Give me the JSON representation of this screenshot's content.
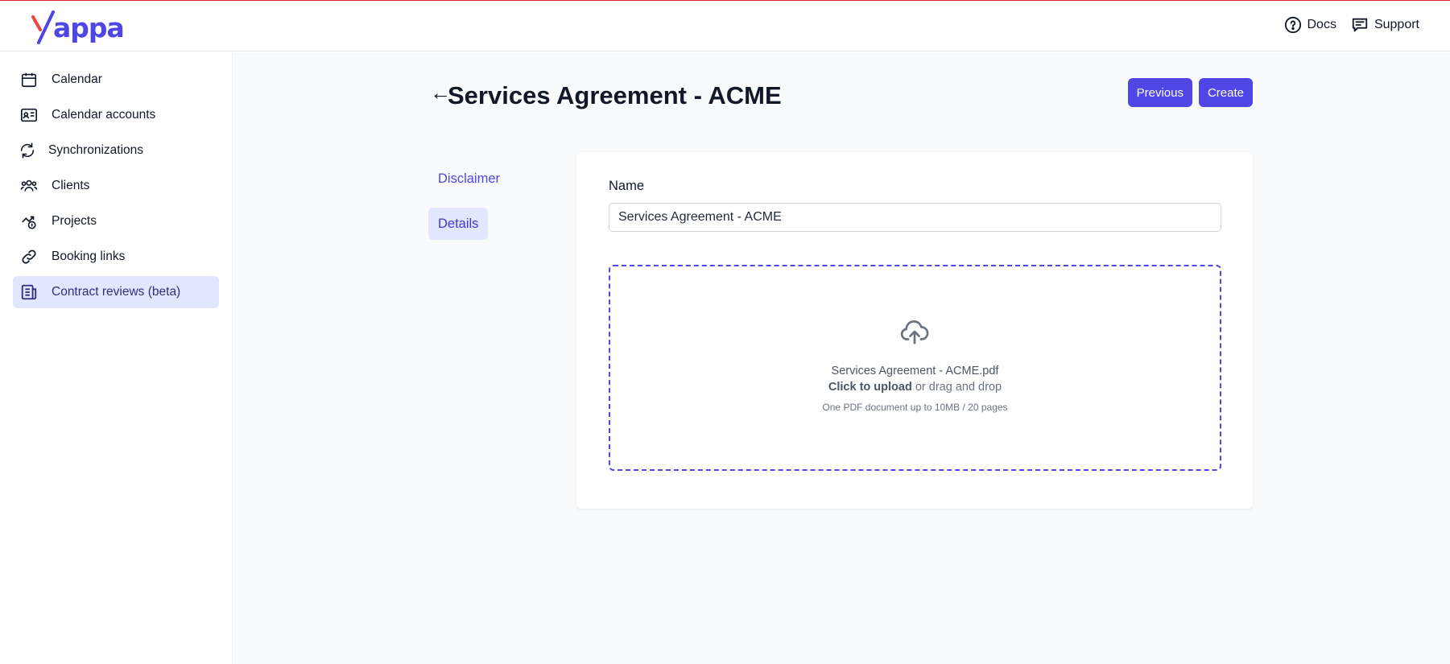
{
  "app": {
    "logo_text": "appa",
    "brand_color": "#4f46e5",
    "accent_red": "#ef4444"
  },
  "header": {
    "docs_label": "Docs",
    "support_label": "Support",
    "docs_icon": "question-circle-icon",
    "support_icon": "chat-bubble-icon"
  },
  "sidebar": {
    "items": [
      {
        "label": "Calendar",
        "icon": "calendar-icon"
      },
      {
        "label": "Calendar accounts",
        "icon": "id-card-icon"
      },
      {
        "label": "Synchronizations",
        "icon": "refresh-icon"
      },
      {
        "label": "Clients",
        "icon": "users-icon"
      },
      {
        "label": "Projects",
        "icon": "projects-icon"
      },
      {
        "label": "Booking links",
        "icon": "link-icon"
      },
      {
        "label": "Contract reviews (beta)",
        "icon": "document-icon",
        "active": true
      }
    ]
  },
  "page": {
    "back_glyph": "←",
    "title": "Services Agreement - ACME",
    "previous_label": "Previous",
    "create_label": "Create"
  },
  "tabs": [
    {
      "label": "Disclaimer",
      "active": false
    },
    {
      "label": "Details",
      "active": true
    }
  ],
  "form": {
    "name_label": "Name",
    "name_value": "Services Agreement - ACME"
  },
  "upload": {
    "icon": "cloud-upload-icon",
    "file_name": "Services Agreement - ACME.pdf",
    "click_text": "Click to upload",
    "drag_text": " or drag and drop",
    "hint": "One PDF document up to 10MB / 20 pages"
  }
}
